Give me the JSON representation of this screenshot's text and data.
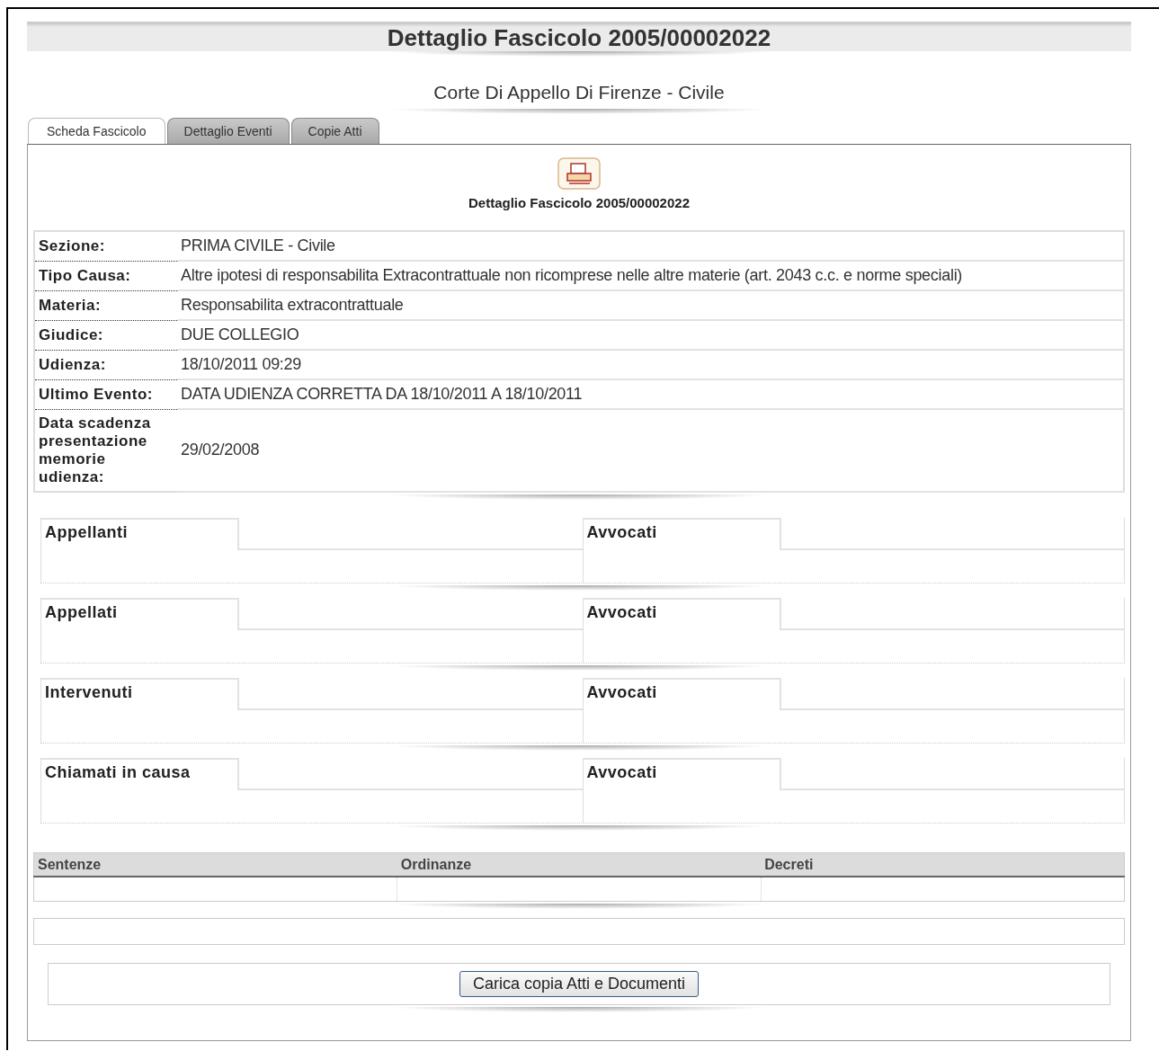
{
  "page_title": "Dettaglio Fascicolo 2005/00002022",
  "court": "Corte Di Appello Di Firenze - Civile",
  "tabs": [
    {
      "label": "Scheda Fascicolo",
      "selected": true
    },
    {
      "label": "Dettaglio Eventi",
      "selected": false
    },
    {
      "label": "Copie Atti",
      "selected": false
    }
  ],
  "print_caption": "Dettaglio Fascicolo 2005/00002022",
  "details": [
    {
      "label": "Sezione:",
      "value": "PRIMA CIVILE - Civile"
    },
    {
      "label": "Tipo Causa:",
      "value": "Altre ipotesi di responsabilita Extracontrattuale non ricomprese nelle altre materie (art. 2043 c.c. e norme speciali)"
    },
    {
      "label": "Materia:",
      "value": "Responsabilita extracontrattuale"
    },
    {
      "label": "Giudice:",
      "value": "DUE COLLEGIO"
    },
    {
      "label": "Udienza:",
      "value": "18/10/2011 09:29"
    },
    {
      "label": "Ultimo Evento:",
      "value": "DATA UDIENZA CORRETTA DA 18/10/2011 A 18/10/2011"
    },
    {
      "label": "Data scadenza presentazione memorie udienza:",
      "value": "29/02/2008"
    }
  ],
  "parties": [
    {
      "heading": "Appellanti",
      "lawyers_heading": "Avvocati"
    },
    {
      "heading": "Appellati",
      "lawyers_heading": "Avvocati"
    },
    {
      "heading": "Intervenuti",
      "lawyers_heading": "Avvocati"
    },
    {
      "heading": "Chiamati in causa",
      "lawyers_heading": "Avvocati"
    }
  ],
  "documents_table": {
    "columns": [
      "Sentenze",
      "Ordinanze",
      "Decreti"
    ]
  },
  "upload_button": "Carica copia Atti e Documenti"
}
